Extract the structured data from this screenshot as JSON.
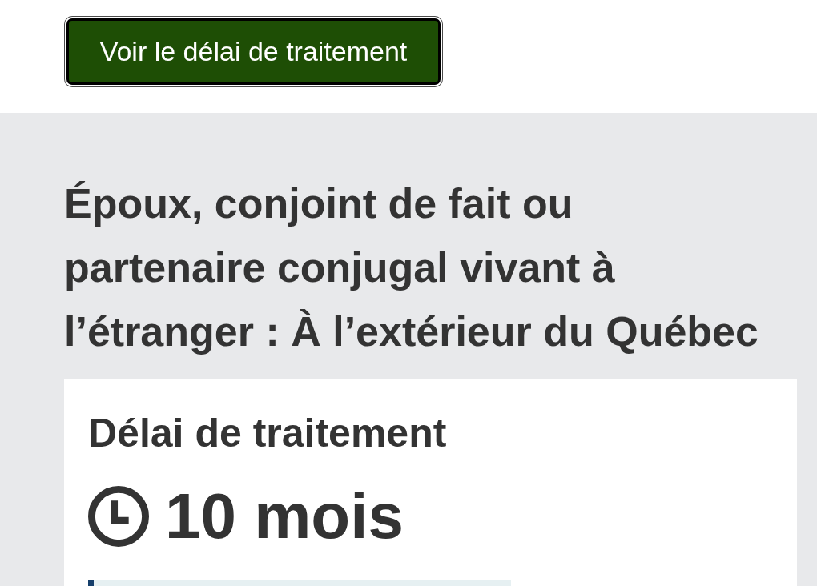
{
  "action_button": {
    "label": "Voir le délai de traitement"
  },
  "heading": "Époux, conjoint de fait ou partenaire conjugal vivant à l’étranger : À l’extérieur du Québec",
  "processing_card": {
    "title": "Délai de traitement",
    "duration": "10 mois"
  }
}
